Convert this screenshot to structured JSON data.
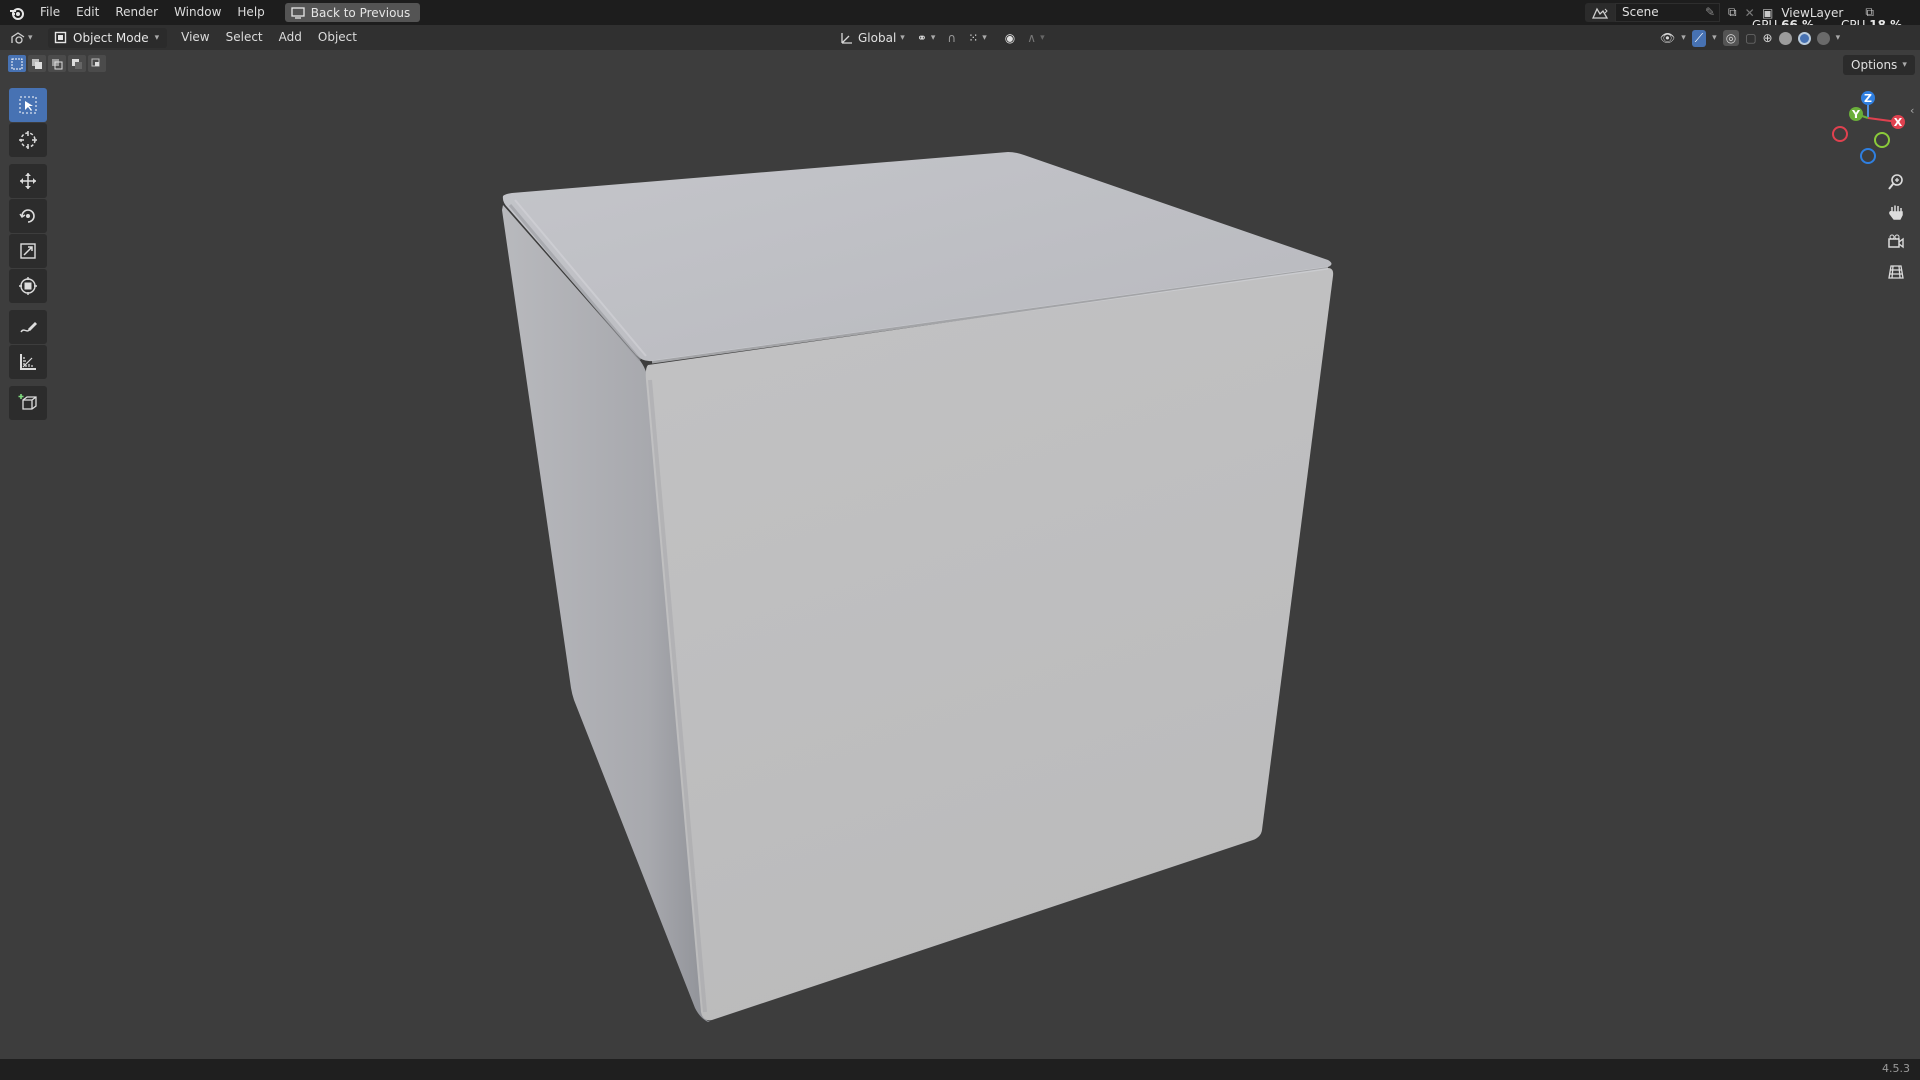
{
  "menu": {
    "items": [
      "File",
      "Edit",
      "Render",
      "Window",
      "Help"
    ],
    "back_button": "Back to Previous"
  },
  "scene": {
    "name": "Scene"
  },
  "view_layer": {
    "name": "ViewLayer"
  },
  "stats": {
    "gpu_label": "GPU",
    "gpu_value": "66 %",
    "cpu_label": "CPU",
    "cpu_value": "18 %"
  },
  "header": {
    "mode": "Object Mode",
    "menus": [
      "View",
      "Select",
      "Add",
      "Object"
    ],
    "orientation": "Global"
  },
  "options_label": "Options",
  "gizmo": {
    "x": "X",
    "y": "Y",
    "z": "Z"
  },
  "version": "4.5.3",
  "colors": {
    "accent": "#4772b3",
    "bg": "#3d3d3d",
    "header": "#303030",
    "topbar": "#1d1d1d"
  }
}
